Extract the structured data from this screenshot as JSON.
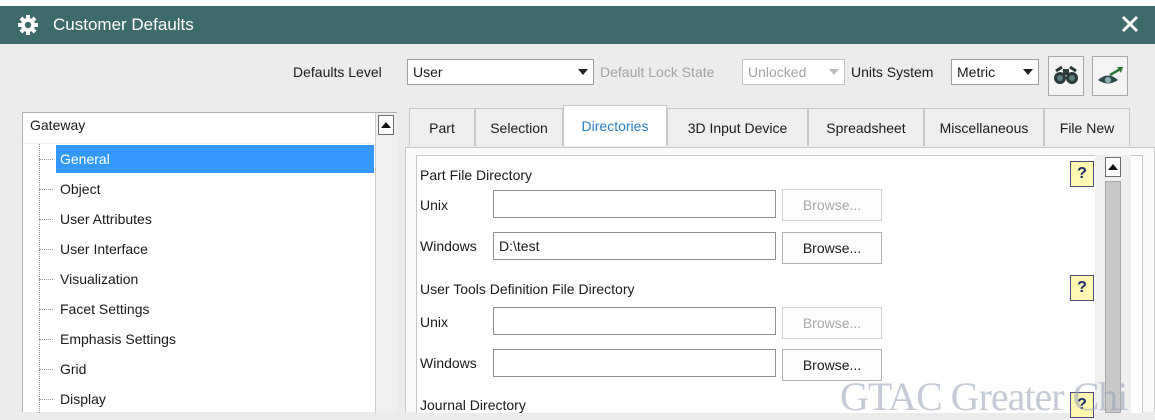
{
  "window": {
    "title": "Customer Defaults",
    "close_icon": "close-icon",
    "app_icon": "gear-icon",
    "title_color": "#3d6a6b"
  },
  "toolbar": {
    "defaults_level_label": "Defaults Level",
    "defaults_level_value": "User",
    "lock_state_label": "Default Lock State",
    "lock_state_value": "Unlocked",
    "units_label": "Units System",
    "units_value": "Metric",
    "icon_buttons": [
      "binoculars-icon",
      "eye-arrow-icon"
    ]
  },
  "tree": {
    "root": "Gateway",
    "items": [
      "General",
      "Object",
      "User Attributes",
      "User Interface",
      "Visualization",
      "Facet Settings",
      "Emphasis Settings",
      "Grid",
      "Display"
    ],
    "selected_index": 0,
    "selection_color": "#3399ff"
  },
  "tabs": [
    "Part",
    "Selection",
    "Directories",
    "3D Input Device",
    "Spreadsheet",
    "Miscellaneous",
    "File New"
  ],
  "active_tab": "Directories",
  "directories": {
    "part_file": {
      "heading": "Part File Directory",
      "unix_label": "Unix",
      "unix_value": "",
      "unix_browse": "Browse...",
      "windows_label": "Windows",
      "windows_value": "D:\\test",
      "windows_browse": "Browse..."
    },
    "user_tools": {
      "heading": "User Tools Definition File Directory",
      "unix_label": "Unix",
      "unix_value": "",
      "unix_browse": "Browse...",
      "windows_label": "Windows",
      "windows_value": "",
      "windows_browse": "Browse..."
    },
    "journal": {
      "heading": "Journal Directory"
    },
    "help_glyph": "?"
  },
  "watermark": "GTAC Greater Chi"
}
